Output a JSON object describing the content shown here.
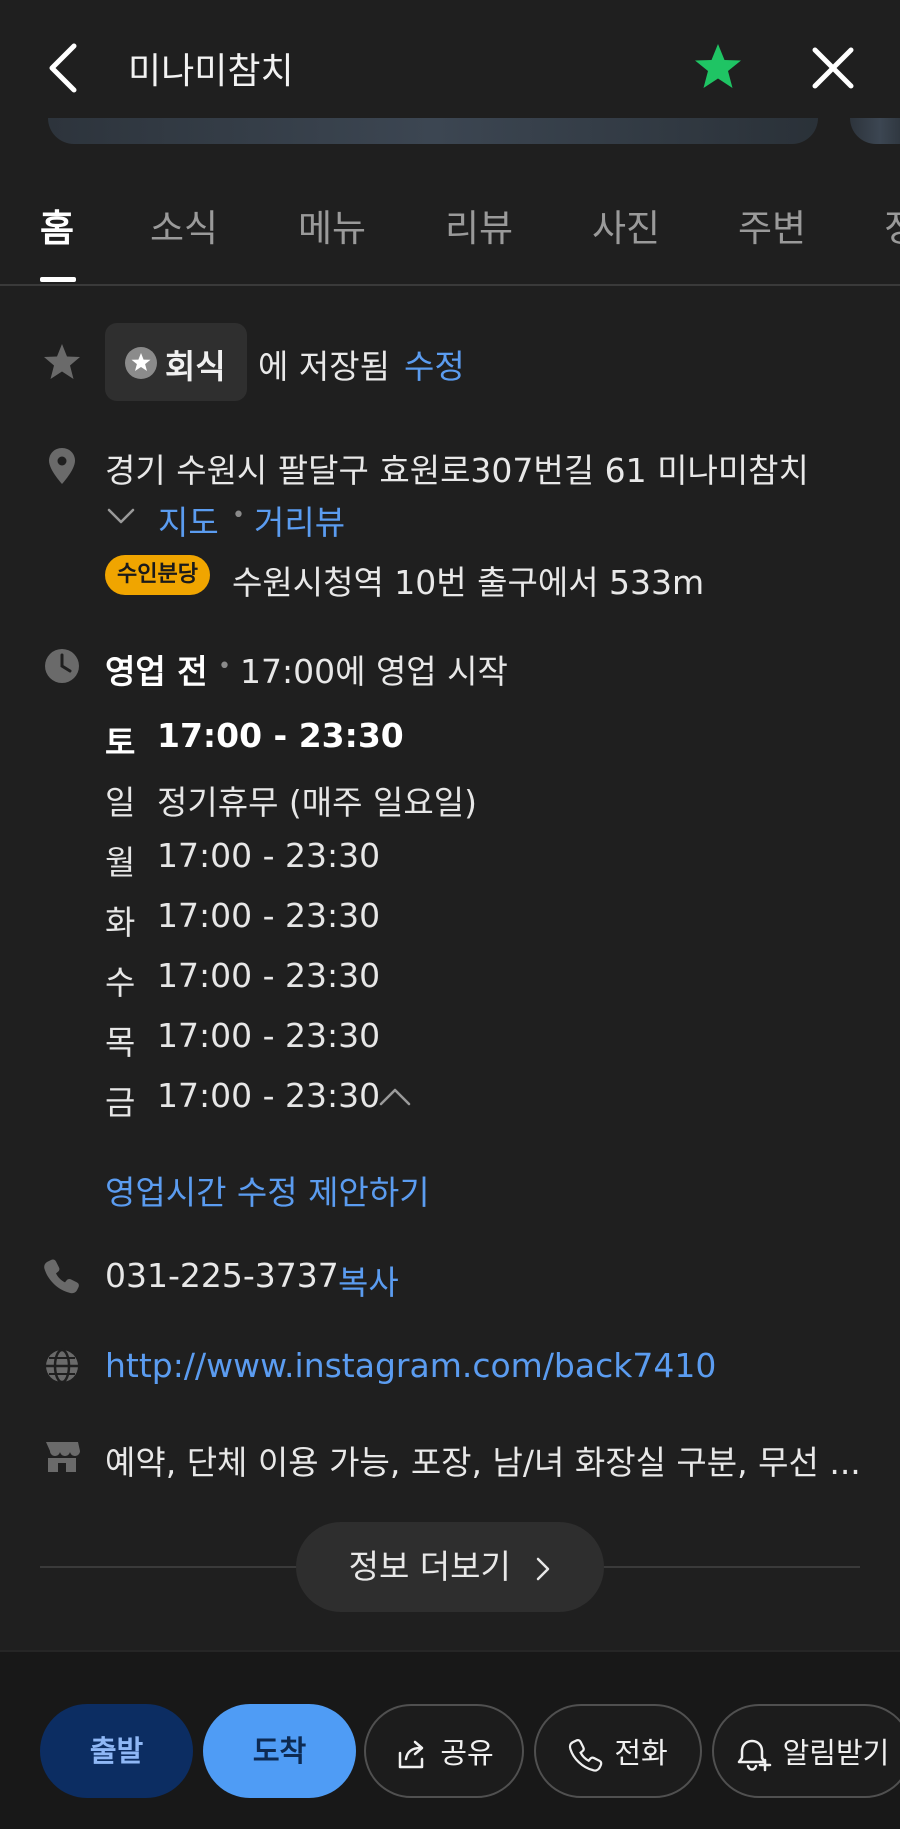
{
  "header": {
    "title": "미나미참치",
    "star_color": "#1fc464"
  },
  "tabs": [
    {
      "label": "홈",
      "active": true
    },
    {
      "label": "소식"
    },
    {
      "label": "메뉴"
    },
    {
      "label": "리뷰"
    },
    {
      "label": "사진"
    },
    {
      "label": "주변"
    },
    {
      "label": "정"
    }
  ],
  "saved": {
    "list_name": "회식",
    "suffix": "에 저장됨",
    "edit": "수정"
  },
  "address": {
    "text": "경기 수원시 팔달구 효원로307번길 61 미나미참치",
    "map_link": "지도",
    "separator": "•",
    "streetview_link": "거리뷰",
    "subway_line": "수인분당",
    "subway_line_color": "#f0a500",
    "subway_text": "수원시청역 10번 출구에서 533m"
  },
  "hours": {
    "status": "영업 전",
    "separator": "•",
    "status_detail": "17:00에 영업 시작",
    "rows": [
      {
        "day": "토",
        "time": "17:00 - 23:30"
      },
      {
        "day": "일",
        "time": "정기휴무 (매주 일요일)"
      },
      {
        "day": "월",
        "time": "17:00 - 23:30"
      },
      {
        "day": "화",
        "time": "17:00 - 23:30"
      },
      {
        "day": "수",
        "time": "17:00 - 23:30"
      },
      {
        "day": "목",
        "time": "17:00 - 23:30"
      },
      {
        "day": "금",
        "time": "17:00 - 23:30"
      }
    ],
    "suggest_edit": "영업시간 수정 제안하기"
  },
  "phone": {
    "number": "031-225-3737",
    "copy": "복사"
  },
  "website": {
    "url": "http://www.instagram.com/back7410"
  },
  "amenities": {
    "text": "예약, 단체 이용 가능, 포장, 남/녀 화장실 구분, 무선 ..."
  },
  "more_info": {
    "label": "정보 더보기"
  },
  "bottom_bar": {
    "depart": "출발",
    "arrive": "도착",
    "share": "공유",
    "call": "전화",
    "alarm": "알림받기"
  }
}
